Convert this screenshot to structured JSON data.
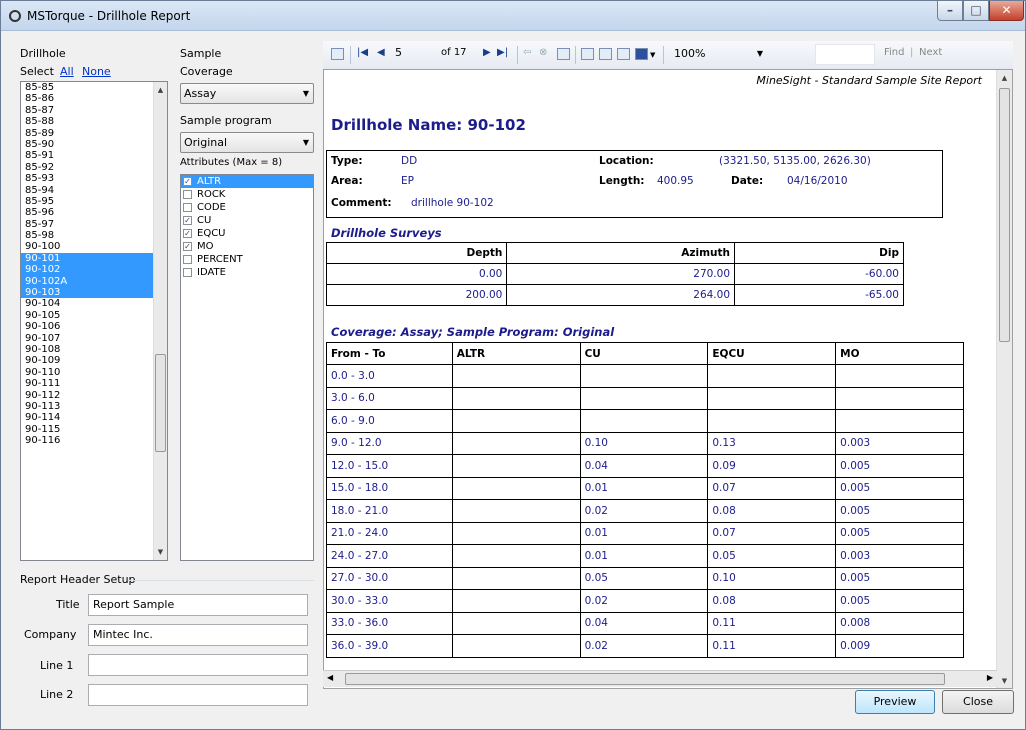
{
  "window": {
    "title": "MSTorque - Drillhole Report"
  },
  "drillhole": {
    "heading": "Drillhole",
    "select_label": "Select",
    "all": "All",
    "none": "None",
    "items": [
      "85-85",
      "85-86",
      "85-87",
      "85-88",
      "85-89",
      "85-90",
      "85-91",
      "85-92",
      "85-93",
      "85-94",
      "85-95",
      "85-96",
      "85-97",
      "85-98",
      "90-100",
      "90-101",
      "90-102",
      "90-102A",
      "90-103",
      "90-104",
      "90-105",
      "90-106",
      "90-107",
      "90-108",
      "90-109",
      "90-110",
      "90-111",
      "90-112",
      "90-113",
      "90-114",
      "90-115",
      "90-116"
    ],
    "selected": [
      "90-101",
      "90-102",
      "90-102A",
      "90-103"
    ]
  },
  "sample": {
    "heading": "Sample",
    "coverage_label": "Coverage",
    "coverage_value": "Assay",
    "program_label": "Sample program",
    "program_value": "Original",
    "attributes_label": "Attributes (Max = 8)",
    "attributes": [
      {
        "name": "ALTR",
        "checked": true,
        "selected": true
      },
      {
        "name": "ROCK",
        "checked": false
      },
      {
        "name": "CODE",
        "checked": false
      },
      {
        "name": "CU",
        "checked": true
      },
      {
        "name": "EQCU",
        "checked": true
      },
      {
        "name": "MO",
        "checked": true
      },
      {
        "name": "PERCENT",
        "checked": false
      },
      {
        "name": "IDATE",
        "checked": false
      }
    ]
  },
  "header_setup": {
    "heading": "Report Header Setup",
    "title_label": "Title",
    "title_value": "Report Sample",
    "company_label": "Company",
    "company_value": "Mintec Inc.",
    "line1_label": "Line 1",
    "line1_value": "",
    "line2_label": "Line 2",
    "line2_value": ""
  },
  "toolbar": {
    "page": "5",
    "of_pages": "of 17",
    "zoom": "100%",
    "find": "Find",
    "next": "Next",
    "divider": "|"
  },
  "report": {
    "site": "MineSight - Standard Sample Site Report",
    "name_title": "Drillhole Name:  90-102",
    "type_label": "Type:",
    "type_value": "DD",
    "location_label": "Location:",
    "location_value": "(3321.50, 5135.00, 2626.30)",
    "area_label": "Area:",
    "area_value": "EP",
    "length_label": "Length:",
    "length_value": "400.95",
    "date_label": "Date:",
    "date_value": "04/16/2010",
    "comment_label": "Comment:",
    "comment_value": "drillhole 90-102",
    "surveys_title": "Drillhole Surveys",
    "surveys_headers": [
      "Depth",
      "Azimuth",
      "Dip"
    ],
    "surveys_rows": [
      [
        "0.00",
        "270.00",
        "-60.00"
      ],
      [
        "200.00",
        "264.00",
        "-65.00"
      ]
    ],
    "coverage_title": "Coverage: Assay;  Sample Program: Original",
    "assay_headers": [
      "From - To",
      "ALTR",
      "CU",
      "EQCU",
      "MO"
    ],
    "assay_rows": [
      [
        "0.0 - 3.0",
        "",
        "",
        "",
        ""
      ],
      [
        "3.0 - 6.0",
        "",
        "",
        "",
        ""
      ],
      [
        "6.0 - 9.0",
        "",
        "",
        "",
        ""
      ],
      [
        "9.0 - 12.0",
        "",
        "0.10",
        "0.13",
        "0.003"
      ],
      [
        "12.0 - 15.0",
        "",
        "0.04",
        "0.09",
        "0.005"
      ],
      [
        "15.0 - 18.0",
        "",
        "0.01",
        "0.07",
        "0.005"
      ],
      [
        "18.0 - 21.0",
        "",
        "0.02",
        "0.08",
        "0.005"
      ],
      [
        "21.0 - 24.0",
        "",
        "0.01",
        "0.07",
        "0.005"
      ],
      [
        "24.0 - 27.0",
        "",
        "0.01",
        "0.05",
        "0.003"
      ],
      [
        "27.0 - 30.0",
        "",
        "0.05",
        "0.10",
        "0.005"
      ],
      [
        "30.0 - 33.0",
        "",
        "0.02",
        "0.08",
        "0.005"
      ],
      [
        "33.0 - 36.0",
        "",
        "0.04",
        "0.11",
        "0.008"
      ],
      [
        "36.0 - 39.0",
        "",
        "0.02",
        "0.11",
        "0.009"
      ]
    ]
  },
  "buttons": {
    "preview": "Preview",
    "close": "Close"
  }
}
